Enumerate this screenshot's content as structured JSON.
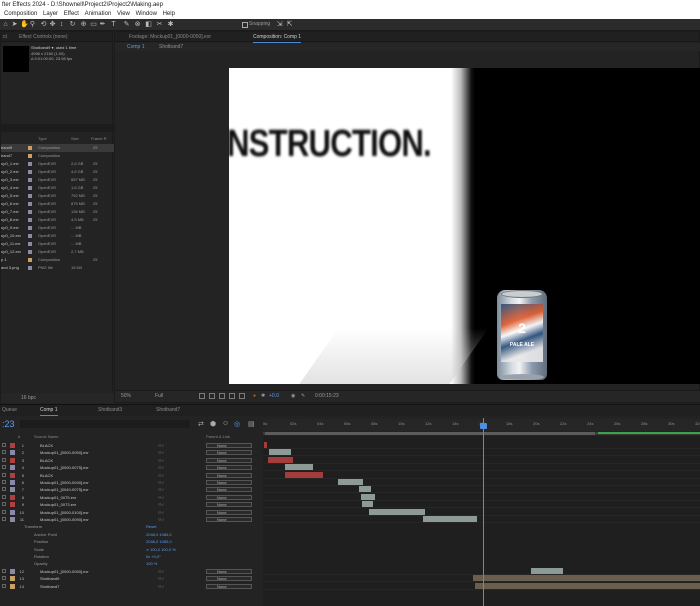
{
  "title_bar": {
    "text": "fter Effects 2024 - D:\\Shownell\\Project2\\Project2\\Making.aep"
  },
  "menu": [
    "Composition",
    "Layer",
    "Effect",
    "Animation",
    "View",
    "Window",
    "Help"
  ],
  "toolbar": {
    "snapping_label": "Snapping"
  },
  "project_panel": {
    "tabs": [
      "ct",
      "Effect Controls (none)"
    ],
    "selected_name": "Shotband9",
    "info_lines": [
      "Shotband9 ▾, used 1 time",
      "4096 x 2160 (1.00)",
      "Δ 0:01:00:00, 23.98 fps"
    ],
    "headers": [
      "",
      "Type",
      "Size",
      "Frame R"
    ],
    "rows": [
      {
        "name": "band9",
        "type": "Composition",
        "size": "",
        "fr": "25",
        "label": "#c9a066",
        "selected": true
      },
      {
        "name": "band7",
        "type": "Composition",
        "size": "",
        "fr": "",
        "label": "#c9a066",
        "selected": false
      },
      {
        "name": "up0_1.exr",
        "type": "OpenEXR",
        "size": "2,6 GB",
        "fr": "25",
        "label": "#8a8aa8",
        "selected": false
      },
      {
        "name": "up0_2.exr",
        "type": "OpenEXR",
        "size": "4,6 GB",
        "fr": "25",
        "label": "#8a8aa8",
        "selected": false
      },
      {
        "name": "up0_3.exr",
        "type": "OpenEXR",
        "size": "657 MB",
        "fr": "25",
        "label": "#8a8aa8",
        "selected": false
      },
      {
        "name": "up0_4.exr",
        "type": "OpenEXR",
        "size": "1,6 GB",
        "fr": "25",
        "label": "#8a8aa8",
        "selected": false
      },
      {
        "name": "up0_5.exr",
        "type": "OpenEXR",
        "size": "792 MB",
        "fr": "25",
        "label": "#8a8aa8",
        "selected": false
      },
      {
        "name": "up0_6.exr",
        "type": "OpenEXR",
        "size": "875 MB",
        "fr": "25",
        "label": "#8a8aa8",
        "selected": false
      },
      {
        "name": "up0_7.exr",
        "type": "OpenEXR",
        "size": "136 MB",
        "fr": "25",
        "label": "#8a8aa8",
        "selected": false
      },
      {
        "name": "up0_8.exr",
        "type": "OpenEXR",
        "size": "4,5 MB",
        "fr": "25",
        "label": "#8a8aa8",
        "selected": false
      },
      {
        "name": "up0_9.exr",
        "type": "OpenEXR",
        "size": "... MB",
        "fr": "",
        "label": "#8a8aa8",
        "selected": false
      },
      {
        "name": "up0_10.exr",
        "type": "OpenEXR",
        "size": "... MB",
        "fr": "",
        "label": "#8a8aa8",
        "selected": false
      },
      {
        "name": "up0_11.exr",
        "type": "OpenEXR",
        "size": "... MB",
        "fr": "",
        "label": "#8a8aa8",
        "selected": false
      },
      {
        "name": "up0_12.exr",
        "type": "OpenEXR",
        "size": "2,7 MB",
        "fr": "",
        "label": "#8a8aa8",
        "selected": false
      },
      {
        "name": "p 1",
        "type": "Composition",
        "size": "",
        "fr": "25",
        "label": "#c9a066",
        "selected": false
      },
      {
        "name": "and 3.png",
        "type": "PNG file",
        "size": "15 KB",
        "fr": "",
        "label": "#8a8aa8",
        "selected": false
      }
    ],
    "footer": "16 bpc"
  },
  "viewer": {
    "tabs": [
      "Footage: Mockup01_[0000-0050].exr",
      "Composition: Comp 1"
    ],
    "sub_tabs": [
      "Comp 1",
      "Shotband7"
    ],
    "canvas_text": "NSTRUCTION.",
    "can_logo": "2",
    "can_name": "PALE ALE",
    "zoom": "50%",
    "resolution": "Full",
    "exposure": "+0.0",
    "timecode": "0:00:15:23"
  },
  "timeline": {
    "tabs": [
      "Queue",
      "Comp 1",
      "Shotband3",
      "Shotband7"
    ],
    "current_time": ":23",
    "headers": [
      "#",
      "Source Name",
      "Parent & Link"
    ],
    "ruler_ticks": [
      "0s",
      "02s",
      "04s",
      "06s",
      "08s",
      "10s",
      "12s",
      "14s",
      "16s",
      "18s",
      "20s",
      "22s",
      "24s",
      "26s",
      "28s",
      "30s",
      "32s"
    ],
    "layers": [
      {
        "num": "1",
        "name": "BLACK",
        "label": "#b04040",
        "parent": "None"
      },
      {
        "num": "2",
        "name": "Mockup01_[0000-0050].exr",
        "label": "#8a8aa8",
        "parent": "None"
      },
      {
        "num": "3",
        "name": "BLACK",
        "label": "#b04040",
        "parent": "None"
      },
      {
        "num": "4",
        "name": "Mockup01_[0000-0075].exr",
        "label": "#8a8aa8",
        "parent": "None"
      },
      {
        "num": "5",
        "name": "BLACK",
        "label": "#b04040",
        "parent": "None"
      },
      {
        "num": "6",
        "name": "Mockup01_[0000-0040].exr",
        "label": "#8a8aa8",
        "parent": "None"
      },
      {
        "num": "7",
        "name": "Mockup01_[0040-0075].exr",
        "label": "#8a8aa8",
        "parent": "None"
      },
      {
        "num": "8",
        "name": "Mockup01_0075.exr",
        "label": "#b04040",
        "parent": "None"
      },
      {
        "num": "9",
        "name": "Mockup01_0073.exr",
        "label": "#b04040",
        "parent": "None"
      },
      {
        "num": "10",
        "name": "Mockup01_[0000-0100].exr",
        "label": "#8a8aa8",
        "parent": "None"
      },
      {
        "num": "11",
        "name": "Mockup01_[0000-0090].exr",
        "label": "#8a8aa8",
        "parent": "None"
      }
    ],
    "transform": {
      "label": "Transform",
      "reset": "Reset",
      "props": [
        {
          "name": "Anchor Point",
          "value": "2048,0  1080,0"
        },
        {
          "name": "Position",
          "value": "2048,0  1080,0"
        },
        {
          "name": "Scale",
          "value": "∞ 100,0  100,0 %"
        },
        {
          "name": "Rotation",
          "value": "0x +0,0°"
        },
        {
          "name": "Opacity",
          "value": "100 %"
        }
      ]
    },
    "layers_bottom": [
      {
        "num": "12",
        "name": "Mockup01_[0000-0050].exr",
        "label": "#8a8aa8",
        "parent": "None"
      },
      {
        "num": "13",
        "name": "Shotband9",
        "label": "#c9a066",
        "parent": "None"
      },
      {
        "num": "14",
        "name": "Shotband7",
        "label": "#c9a066",
        "parent": "None"
      }
    ],
    "colors": {
      "bar_gray": "#8e9a96",
      "bar_red": "#a43c3c",
      "bar_tan": "#6a5f4f",
      "playhead": "#4d8fe0"
    }
  }
}
